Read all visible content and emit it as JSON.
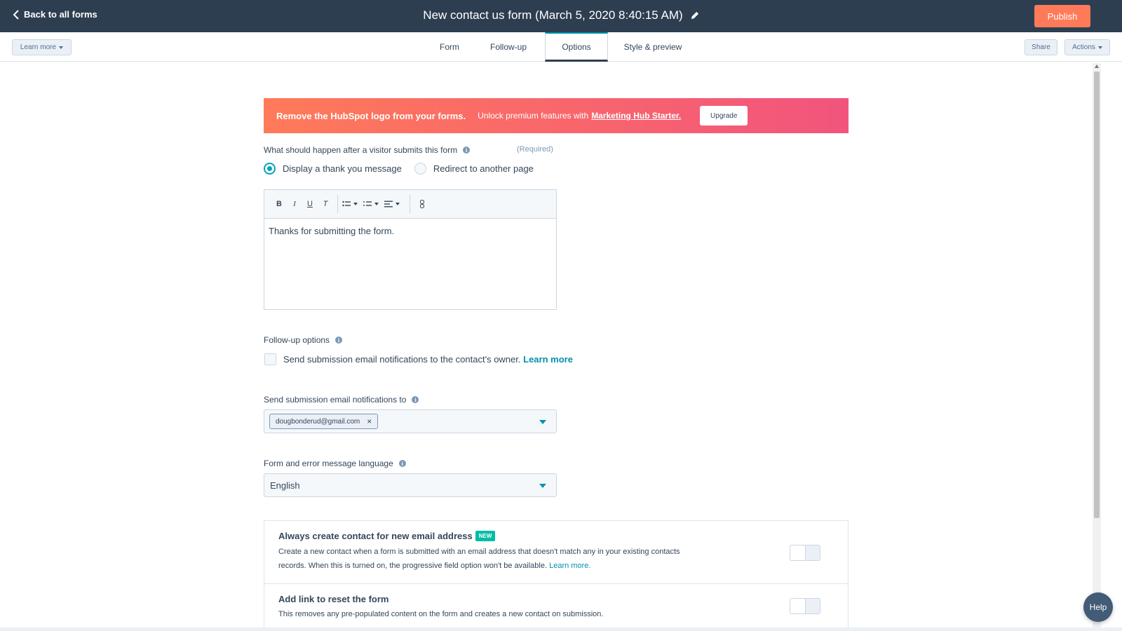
{
  "header": {
    "back_label": "Back to all forms",
    "form_title": "New contact us form (March 5, 2020 8:40:15 AM)",
    "publish_label": "Publish"
  },
  "subnav": {
    "learn_more_label": "Learn more",
    "tabs": [
      {
        "label": "Form"
      },
      {
        "label": "Follow-up"
      },
      {
        "label": "Options",
        "active": true
      },
      {
        "label": "Style & preview"
      }
    ],
    "share_label": "Share",
    "actions_label": "Actions"
  },
  "banner": {
    "heading": "Remove the HubSpot logo from your forms.",
    "text": "Unlock premium features with",
    "link": "Marketing Hub Starter.",
    "button": "Upgrade"
  },
  "after_submit": {
    "label": "What should happen after a visitor submits this form",
    "required": "(Required)",
    "options": [
      {
        "label": "Display a thank you message",
        "selected": true
      },
      {
        "label": "Redirect to another page",
        "selected": false
      }
    ]
  },
  "editor": {
    "toolbar": [
      "bold-icon",
      "italic-icon",
      "underline-icon",
      "clear-format-icon",
      "bullet-list-icon",
      "numbered-list-icon",
      "align-icon",
      "link-icon"
    ],
    "bold": "B",
    "italic": "I",
    "underline": "U",
    "clear": "T",
    "content": "Thanks for submitting the form."
  },
  "follow_up": {
    "label": "Follow-up options",
    "checkbox_text": "Send submission email notifications to the contact's owner.",
    "link": "Learn more",
    "checked": false
  },
  "notifications": {
    "label": "Send submission email notifications to",
    "chip": "dougbonderud@gmail.com",
    "chip_remove": "×"
  },
  "language": {
    "label": "Form and error message language",
    "value": "English"
  },
  "settings": [
    {
      "title": "Always create contact for new email address",
      "badge": "NEW",
      "desc_line1": "Create a new contact when a form is submitted with an email address that doesn't match any in your existing contacts",
      "desc_line2": "records. When this is turned on, the progressive field option won't be available.",
      "link": "Learn more.",
      "enabled": false
    },
    {
      "title": "Add link to reset the form",
      "desc": "This removes any pre-populated content on the form and creates a new contact on submission.",
      "enabled": false
    }
  ],
  "help_label": "Help",
  "colors": {
    "topbar": "#2d3e50",
    "publish": "#ff7a59",
    "accent": "#0091ae",
    "badge": "#00bda5"
  }
}
